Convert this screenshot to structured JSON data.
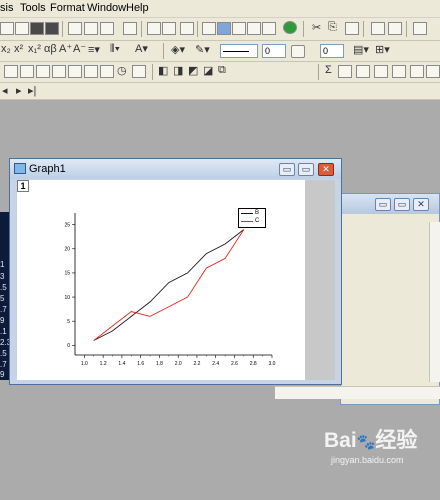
{
  "menubar": {
    "items": [
      "sis",
      "Tools",
      "Format",
      "Window",
      "Help"
    ]
  },
  "toolbar": {
    "line_width": "0",
    "fill_value": "0"
  },
  "graph_window": {
    "title": "Graph1",
    "layer_number": "1",
    "minimize_glyph": "▭",
    "restore_glyph": "▭",
    "close_glyph": "✕"
  },
  "background_window": {
    "minimize_glyph": "▭",
    "restore_glyph": "▭",
    "close_glyph": "✕"
  },
  "left_strip": {
    "row_labels": [
      "1",
      "3",
      ".5",
      "5",
      ".7",
      "9",
      ".1",
      "2.3",
      ".5",
      ".7",
      "9"
    ]
  },
  "watermark": {
    "brand": "Bai",
    "brand_suffix": "经验",
    "url": "jingyan.baidu.com"
  },
  "chart_data": {
    "type": "line",
    "xlim": [
      0.9,
      3.0
    ],
    "ylim": [
      -2,
      27
    ],
    "xticks": [
      "1.0",
      "1.2",
      "1.4",
      "1.6",
      "1.8",
      "2.0",
      "2.2",
      "2.4",
      "2.6",
      "2.8",
      "3.0"
    ],
    "yticks": [
      "0",
      "5",
      "10",
      "15",
      "20",
      "25"
    ],
    "legend": {
      "position": "top-right",
      "entries": [
        "B",
        "C"
      ]
    },
    "series": [
      {
        "name": "B",
        "color": "#1a1a1a",
        "x": [
          1.1,
          1.3,
          1.5,
          1.7,
          1.9,
          2.1,
          2.3,
          2.5,
          2.7
        ],
        "y": [
          1,
          3,
          6,
          9,
          13,
          15,
          19,
          21,
          24
        ]
      },
      {
        "name": "C",
        "color": "#e8251f",
        "x": [
          1.1,
          1.3,
          1.5,
          1.7,
          1.9,
          2.1,
          2.3,
          2.5,
          2.7
        ],
        "y": [
          1,
          4,
          7,
          6,
          8,
          10,
          16,
          18,
          24
        ]
      }
    ]
  }
}
